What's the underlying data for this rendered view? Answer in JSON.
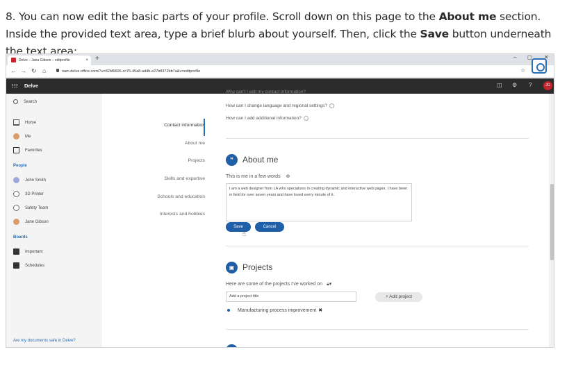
{
  "instruction": {
    "part1": "8. You can now edit the basic parts of your profile. Scroll down on this page to the ",
    "bold1": "About me",
    "part2": " section. Inside the provided text area, type a brief blurb about yourself. Then, click the ",
    "bold2": "Save",
    "part3": " button underneath the text area:"
  },
  "browser": {
    "tab_title": "Delve – Jana Gibson – editprofile",
    "tab_close": "×",
    "new_tab": "+",
    "url": "nam.delve.office.com/?u=82bf6606-cc75-45a8-ad4b-e27b8372bb7a&v=editprofile"
  },
  "appbar": {
    "name": "Delve",
    "avatar_initials": "JG"
  },
  "leftnav": {
    "search": "Search",
    "main": [
      {
        "label": "Home"
      },
      {
        "label": "Me"
      },
      {
        "label": "Favorites"
      }
    ],
    "people_header": "People",
    "people": [
      {
        "label": "John Smith"
      },
      {
        "label": "3D Printer"
      },
      {
        "label": "Safety Team"
      },
      {
        "label": "Jane Gibson"
      }
    ],
    "boards_header": "Boards",
    "boards": [
      {
        "label": "Important"
      },
      {
        "label": "Schedules"
      }
    ],
    "footer": "Are my documents safe in Delve?"
  },
  "sections_nav": [
    {
      "label": "Contact information"
    },
    {
      "label": "About me"
    },
    {
      "label": "Projects"
    },
    {
      "label": "Skills and expertise"
    },
    {
      "label": "Schools and education"
    },
    {
      "label": "Interests and hobbies"
    }
  ],
  "faq": {
    "q0": "Why can't I edit my contact information?",
    "q1": "How can I change language and regional settings?",
    "q2": "How can I add additional information?"
  },
  "about": {
    "title": "About me",
    "label": "This is me in a few words",
    "text": "I am a web designer from LA who specializes in creating dynamic and interactive web pages. I have been in field for over seven years and have loved every minute of it.",
    "save": "Save",
    "cancel": "Cancel"
  },
  "projects": {
    "title": "Projects",
    "label": "Here are some of the projects I've worked on",
    "placeholder": "Add a project title",
    "add": "+ Add project",
    "items": [
      {
        "label": "Manufacturing process improvement"
      }
    ],
    "remove": "✖"
  },
  "colors": {
    "accent": "#1f5fa8",
    "appbar": "#2b2b2b",
    "avatar": "#c4262e"
  }
}
